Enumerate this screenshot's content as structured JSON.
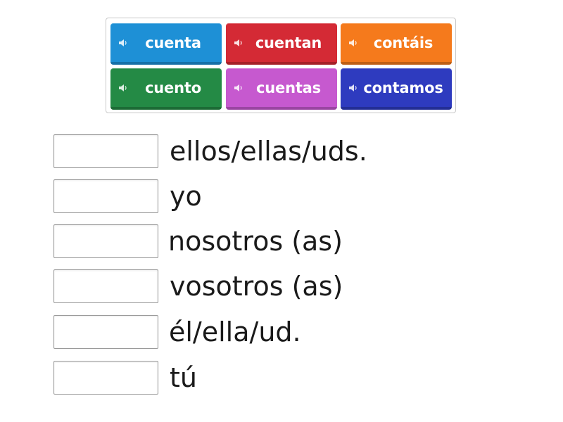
{
  "tiles": [
    {
      "label": "cuenta",
      "color": "#1e90d6",
      "icon": "speaker-icon"
    },
    {
      "label": "cuentan",
      "color": "#d42a35",
      "icon": "speaker-icon"
    },
    {
      "label": "contáis",
      "color": "#f57a1c",
      "icon": "speaker-icon"
    },
    {
      "label": "cuento",
      "color": "#248a45",
      "icon": "speaker-icon"
    },
    {
      "label": "cuentas",
      "color": "#c659cf",
      "icon": "speaker-icon"
    },
    {
      "label": "contamos",
      "color": "#2e3bbf",
      "icon": "speaker-icon"
    }
  ],
  "targets": [
    {
      "label": "ellos/ellas/uds."
    },
    {
      "label": "yo"
    },
    {
      "label": "nosotros (as)"
    },
    {
      "label": "vosotros (as)"
    },
    {
      "label": "él/ella/ud."
    },
    {
      "label": "tú"
    }
  ]
}
